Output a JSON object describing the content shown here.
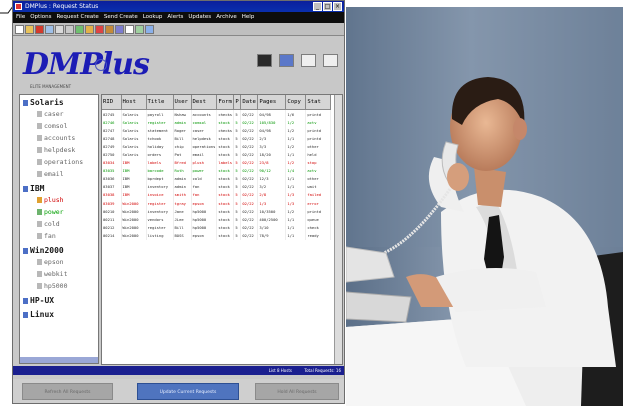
{
  "window": {
    "title": "DMPlus : Request Status"
  },
  "menu": [
    "File",
    "Options",
    "Request Create",
    "Send Create",
    "Lookup",
    "Alerts",
    "Updates",
    "Archive",
    "Help"
  ],
  "brand": {
    "logo": "DMPlus",
    "tagline": "ELITE MANAGEMENT"
  },
  "tree": {
    "groups": [
      {
        "label": "Solaris",
        "children": [
          {
            "label": "caser",
            "state": "normal"
          },
          {
            "label": "comsol",
            "state": "normal"
          },
          {
            "label": "accounts",
            "state": "normal"
          },
          {
            "label": "helpdesk",
            "state": "normal"
          },
          {
            "label": "operations",
            "state": "normal"
          },
          {
            "label": "email",
            "state": "normal"
          }
        ]
      },
      {
        "label": "IBM",
        "children": [
          {
            "label": "plush",
            "state": "alert"
          },
          {
            "label": "power",
            "state": "ok"
          },
          {
            "label": "cold",
            "state": "normal"
          },
          {
            "label": "fan",
            "state": "normal"
          }
        ]
      },
      {
        "label": "Win2000",
        "children": [
          {
            "label": "epson",
            "state": "normal"
          },
          {
            "label": "webkit",
            "state": "normal"
          },
          {
            "label": "hp5000",
            "state": "normal"
          }
        ]
      },
      {
        "label": "HP-UX",
        "children": []
      },
      {
        "label": "Linux",
        "children": []
      }
    ]
  },
  "table": {
    "headers": [
      "RID",
      "Host",
      "Title",
      "User",
      "Dest",
      "Form",
      "P",
      "Date",
      "Pages",
      "Copy",
      "Stat"
    ],
    "rows": [
      {
        "style": "normal",
        "cells": [
          "02745",
          "Solaris",
          "payroll",
          "Nshaw",
          "accounts",
          "checks",
          "5",
          "02/22",
          "04/98",
          "1/6",
          "printd"
        ]
      },
      {
        "style": "green",
        "cells": [
          "02746",
          "Solaris",
          "register",
          "admin",
          "comsol",
          "stock",
          "5",
          "02/22",
          "105/830",
          "1/2",
          "actv"
        ]
      },
      {
        "style": "normal",
        "cells": [
          "02747",
          "Solaris",
          "statement",
          "Roger",
          "caser",
          "checks",
          "5",
          "02/22",
          "04/98",
          "1/2",
          "printd"
        ]
      },
      {
        "style": "normal",
        "cells": [
          "02748",
          "Solaris",
          "tchook",
          "Bill",
          "helpdesk",
          "stock",
          "5",
          "02/22",
          "2/3",
          "1/1",
          "printd"
        ]
      },
      {
        "style": "normal",
        "cells": [
          "02749",
          "Solaris",
          "holiday",
          "chip",
          "operations",
          "stock",
          "5",
          "02/22",
          "3/3",
          "1/2",
          "other"
        ]
      },
      {
        "style": "normal",
        "cells": [
          "02750",
          "Solaris",
          "orders",
          "Pat",
          "email",
          "stock",
          "5",
          "02/22",
          "18/20",
          "1/1",
          "held"
        ]
      },
      {
        "style": "red",
        "cells": [
          "03034",
          "IBM",
          "labels",
          "Bfred",
          "plush",
          "labels",
          "5",
          "02/22",
          "23/8",
          "1/2",
          "stop"
        ]
      },
      {
        "style": "green",
        "cells": [
          "03035",
          "IBM",
          "barcode",
          "Ruth",
          "power",
          "stock",
          "5",
          "02/22",
          "90/12",
          "1/4",
          "actv"
        ]
      },
      {
        "style": "normal",
        "cells": [
          "03036",
          "IBM",
          "bprdept",
          "admin",
          "cold",
          "stock",
          "5",
          "02/22",
          "12/3",
          "1/1",
          "other"
        ]
      },
      {
        "style": "normal",
        "cells": [
          "03037",
          "IBM",
          "inventory",
          "admin",
          "fan",
          "stock",
          "5",
          "02/22",
          "3/2",
          "1/1",
          "wait"
        ]
      },
      {
        "style": "red",
        "cells": [
          "03038",
          "IBM",
          "invoice",
          "smith",
          "fan",
          "stock",
          "5",
          "02/22",
          "2/8",
          "1/3",
          "failed"
        ]
      },
      {
        "style": "red",
        "cells": [
          "03039",
          "Win2000",
          "register",
          "tgray",
          "epson",
          "stock",
          "5",
          "02/22",
          "1/3",
          "1/3",
          "error"
        ]
      },
      {
        "style": "normal",
        "cells": [
          "00210",
          "Win2000",
          "inventory",
          "Jane",
          "hp5000",
          "stock",
          "5",
          "02/22",
          "10/3500",
          "1/2",
          "printd"
        ]
      },
      {
        "style": "normal",
        "cells": [
          "00211",
          "Win2000",
          "vendors",
          "JLee",
          "hp5000",
          "stock",
          "5",
          "02/22",
          "400/2500",
          "1/1",
          "queue"
        ]
      },
      {
        "style": "normal",
        "cells": [
          "00212",
          "Win2000",
          "register",
          "Bill",
          "hp5000",
          "stock",
          "5",
          "02/22",
          "3/10",
          "1/1",
          "check"
        ]
      },
      {
        "style": "normal",
        "cells": [
          "00214",
          "Win2000",
          "listing",
          "BOSS",
          "epson",
          "stock",
          "5",
          "02/22",
          "78/9",
          "1/1",
          "ready"
        ]
      }
    ]
  },
  "statusbar": {
    "left": "List 8 Hosts",
    "right": "Total Requests: 16"
  },
  "buttons": {
    "primary_left": "Refresh All Requests",
    "primary_center": "Update Current Requests",
    "primary_right": "Hold All Requests"
  },
  "colors": {
    "title_blue": "#0b1f9c",
    "logo_blue": "#1c1cb5",
    "status_blue": "#1a1f8f",
    "alert_red": "#d20000",
    "ok_green": "#009500"
  }
}
